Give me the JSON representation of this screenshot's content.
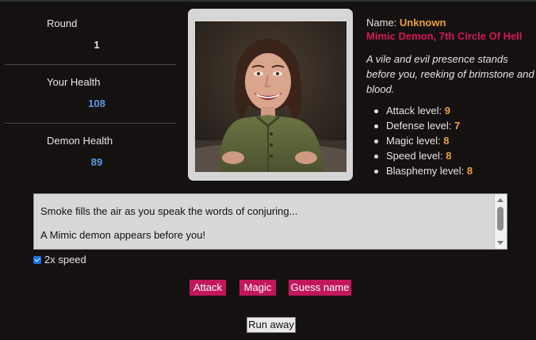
{
  "stats": {
    "round_label": "Round",
    "round_value": "1",
    "your_health_label": "Your Health",
    "your_health_value": "108",
    "demon_health_label": "Demon Health",
    "demon_health_value": "89"
  },
  "demon": {
    "name_label": "Name:",
    "name_value": "Unknown",
    "title": "Mimic Demon, 7th Circle Of Hell",
    "description": "A vile and evil presence stands before you, reeking of brimstone and blood.",
    "levels": [
      {
        "label": "Attack level:",
        "value": "9"
      },
      {
        "label": "Defense level:",
        "value": "7"
      },
      {
        "label": "Magic level:",
        "value": "8"
      },
      {
        "label": "Speed level:",
        "value": "8"
      },
      {
        "label": "Blasphemy level:",
        "value": "8"
      }
    ]
  },
  "log": {
    "lines": [
      "Smoke fills the air as you speak the words of conjuring...",
      "A Mimic demon appears before you!"
    ]
  },
  "speed": {
    "label": "2x speed",
    "checked": true
  },
  "actions": {
    "attack": "Attack",
    "magic": "Magic",
    "guess_name": "Guess name",
    "run_away": "Run away"
  },
  "colors": {
    "background": "#151111",
    "accent_pink": "#c2185b",
    "title_red": "#d4175a",
    "level_orange": "#e9a23a",
    "health_blue": "#5b9be0"
  }
}
